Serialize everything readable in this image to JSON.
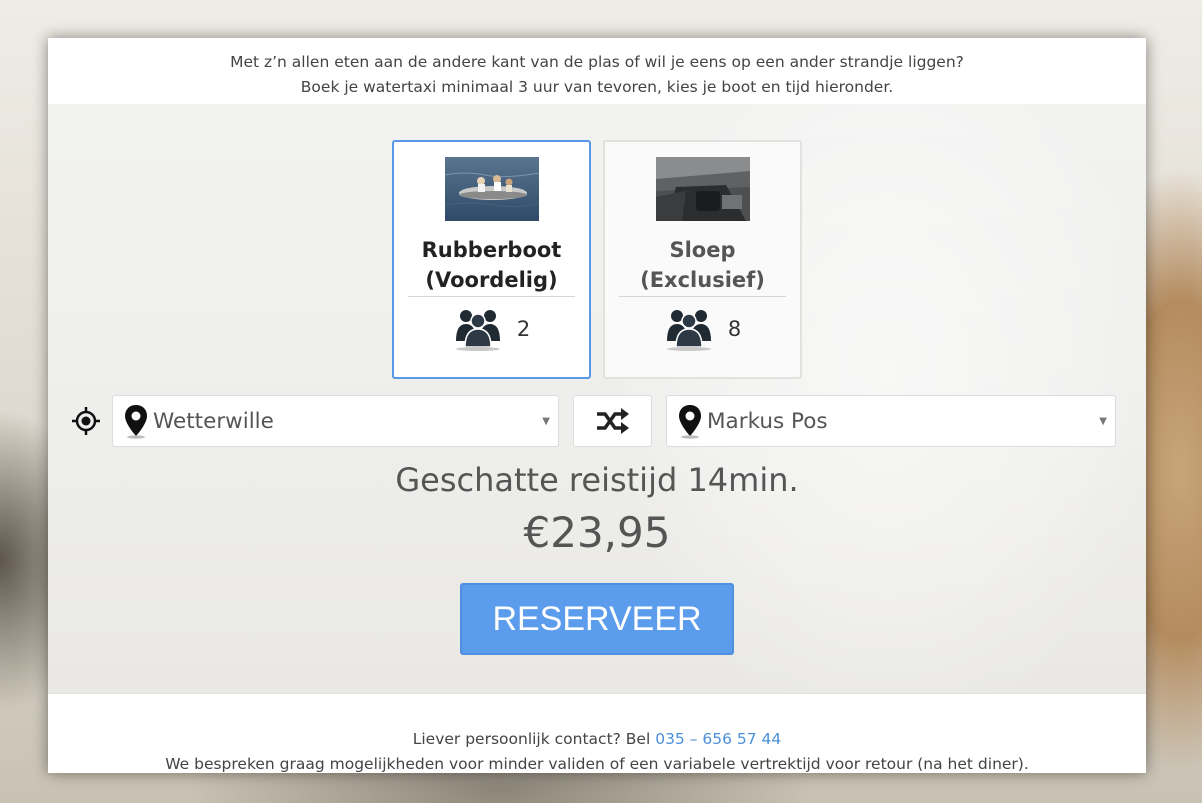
{
  "intro": {
    "line1": "Met z’n allen eten aan de andere kant van de plas of wil je eens op een ander strandje liggen?",
    "line2": "Boek je watertaxi minimaal 3 uur van tevoren, kies je boot en tijd hieronder."
  },
  "boats": [
    {
      "name_line1": "Rubberboot",
      "name_line2": "(Voordelig)",
      "capacity": "2",
      "selected": true,
      "photo_icon": "rubber-boat-photo"
    },
    {
      "name_line1": "Sloep",
      "name_line2": "(Exclusief)",
      "capacity": "8",
      "selected": false,
      "photo_icon": "sloop-boat-photo"
    }
  ],
  "route": {
    "from": "Wetterwille",
    "to": "Markus Pos",
    "gps_icon": "crosshair-icon",
    "swap_icon": "shuffle-icon",
    "pin_icon": "map-pin-icon"
  },
  "estimate": {
    "travel_time": "Geschatte reistijd 14min.",
    "price": "€23,95"
  },
  "reserve_label": "RESERVEER",
  "footer": {
    "contact_prefix": "Liever persoonlijk contact? Bel ",
    "phone": "035 – 656 57 44",
    "line2": "We bespreken graag mogelijkheden voor minder validen of een variabele vertrektijd voor retour (na het diner)."
  },
  "colors": {
    "accent": "#5b9ced",
    "selected_border": "#5b97e8",
    "link": "#4a90d9"
  }
}
